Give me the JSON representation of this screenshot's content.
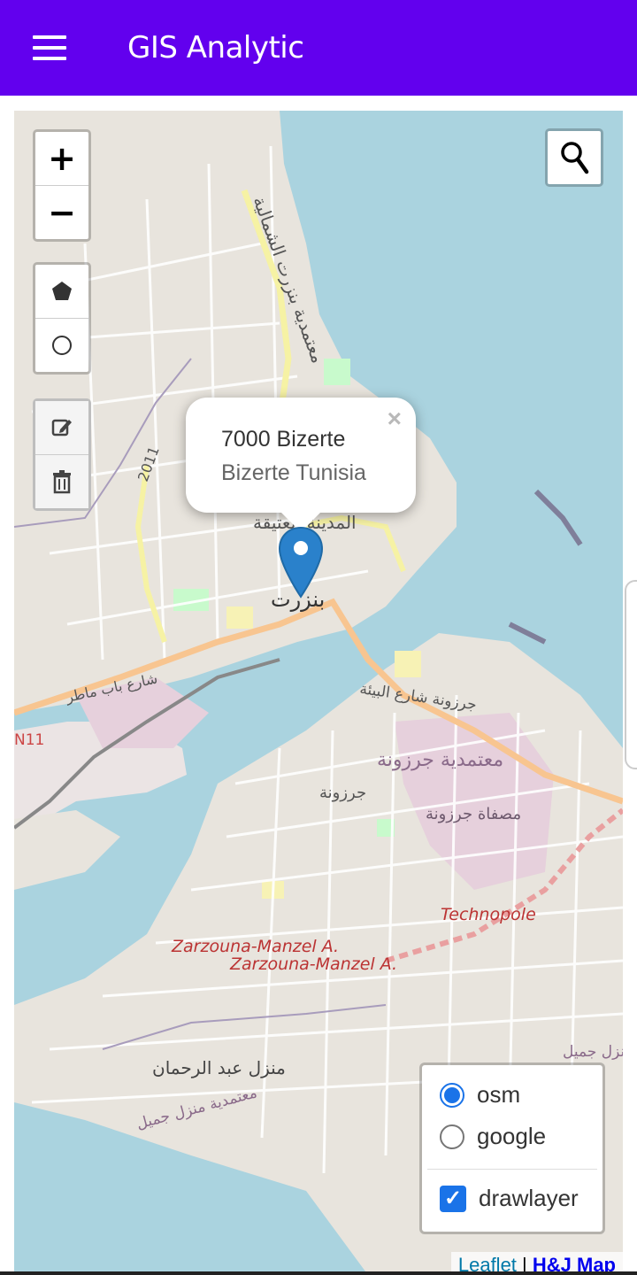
{
  "app": {
    "title": "GIS Analytic",
    "primary_color": "#6200ee",
    "menu_icon": "hamburger-menu-icon"
  },
  "map": {
    "zoom_in_label": "+",
    "zoom_out_label": "−",
    "draw_tools": [
      "polygon-icon",
      "circle-icon"
    ],
    "edit_tools": [
      "edit-icon",
      "trash-icon"
    ],
    "search_icon": "search-icon",
    "labels": {
      "district_north": "معتمدية بنزرت الشمالية",
      "medina": "المدينة العتيقة",
      "city": "بنزرت",
      "road_2011": "2011",
      "bab_mateur": "شارع باب ماطر",
      "n11": "N11",
      "jarzouna_street": "جرزونة شارع البيئة",
      "jarzouna_district": "معتمدية جرزونة",
      "jarzouna": "جرزونة",
      "refinery": "مصفاة جرزونة",
      "technopole": "Technopole",
      "zarzouna1": "Zarzouna-Manzel A.",
      "zarzouna2": "Zarzouna-Manzel A.",
      "menzel_abderrahmane": "منزل عبد الرحمان",
      "menzel_jemil_district": "معتمدية منزل جميل",
      "jemil": "منزل جميل"
    }
  },
  "popup": {
    "line1": "7000 Bizerte",
    "line2": "Bizerte Tunisia",
    "close": "×"
  },
  "layers": {
    "base": [
      {
        "label": "osm",
        "checked": true
      },
      {
        "label": "google",
        "checked": false
      }
    ],
    "overlays": [
      {
        "label": "drawlayer",
        "checked": true
      }
    ]
  },
  "attribution": {
    "leaflet": "Leaflet",
    "separator": " | ",
    "provider": "H&J Map"
  }
}
